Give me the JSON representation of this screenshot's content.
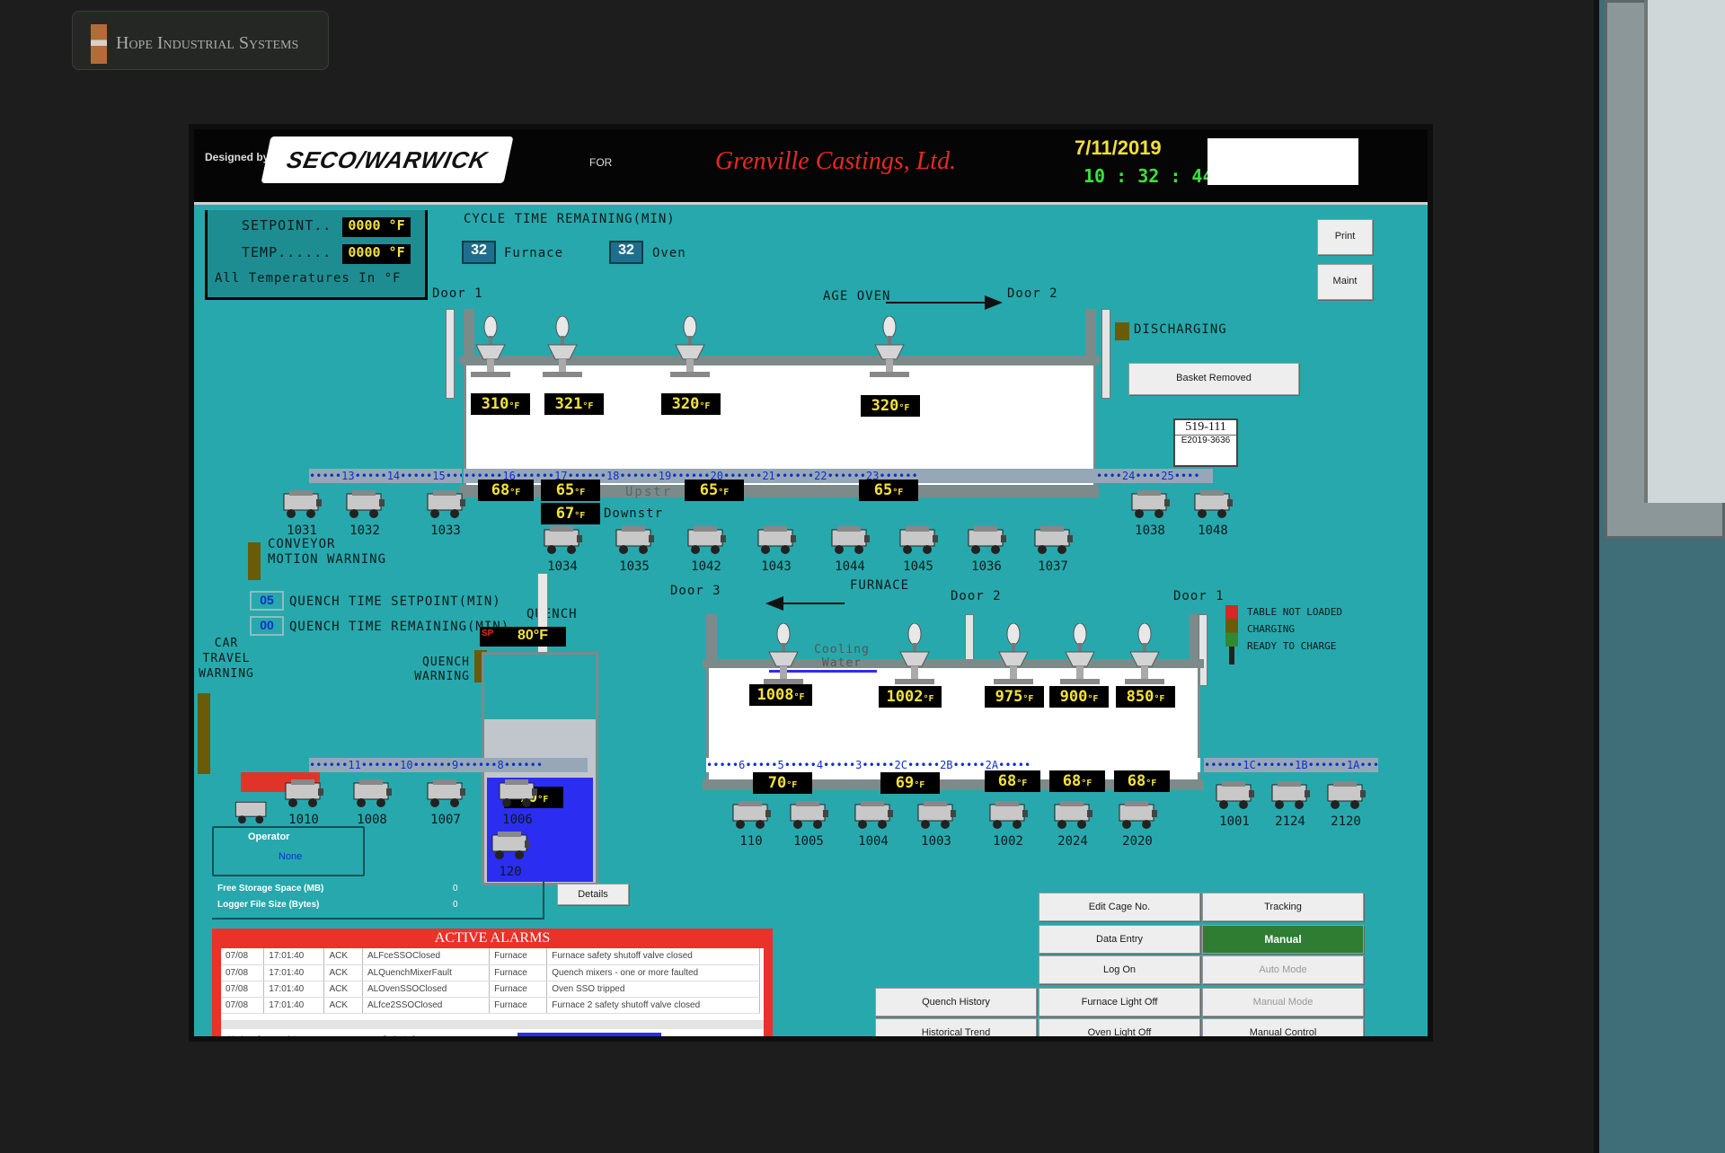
{
  "brand": "Hope Industrial Systems",
  "header": {
    "designed_by": "Designed by",
    "logo": "SECO/WARWICK",
    "for": "FOR",
    "customer": "Grenville Castings, Ltd.",
    "date": "7/11/2019",
    "time": "10 : 32 : 44"
  },
  "setpoint_panel": {
    "setpoint_label": "SETPOINT..",
    "setpoint_value": "0000",
    "temp_label": "TEMP......",
    "temp_value": "0000",
    "unit": "°F",
    "note": "All Temperatures In °F"
  },
  "cycle": {
    "title": "CYCLE TIME REMAINING(MIN)",
    "furnace_value": "32",
    "furnace_label": "Furnace",
    "oven_value": "32",
    "oven_label": "Oven"
  },
  "buttons": {
    "print": "Print",
    "maint": "Maint",
    "basket_removed": "Basket Removed",
    "details": "Details",
    "edit_cage": "Edit Cage No.",
    "tracking": "Tracking",
    "data_entry": "Data Entry",
    "manual": "Manual",
    "log_on": "Log On",
    "auto_mode": "Auto Mode",
    "quench_history": "Quench History",
    "furnace_light_off": "Furnace Light Off",
    "manual_mode": "Manual Mode",
    "historical_trend": "Historical Trend",
    "oven_light_off": "Oven Light Off",
    "manual_control": "Manual Control"
  },
  "age_oven": {
    "title": "AGE OVEN",
    "door1": "Door 1",
    "door2": "Door 2",
    "discharging": "DISCHARGING",
    "top_temps": [
      "310",
      "321",
      "320",
      "320"
    ],
    "bottom_temps": [
      "68",
      "65",
      "65",
      "65"
    ],
    "upstr_label": "Upstr",
    "downstr_value": "67",
    "downstr_label": "Downstr",
    "rail_positions": [
      "13",
      "14",
      "15",
      "16",
      "17",
      "18",
      "19",
      "20",
      "21",
      "22",
      "23",
      "24",
      "25"
    ],
    "tag_number": "519-111",
    "tag_code": "E2019-3636",
    "unit": "°F"
  },
  "upper_carts": {
    "left": [
      "1031",
      "1032",
      "1033"
    ],
    "mid": [
      "1034",
      "1035",
      "1042",
      "1043",
      "1044",
      "1045",
      "1036",
      "1037"
    ],
    "right": [
      "1038",
      "1048"
    ]
  },
  "conveyor_warning": "CONVEYOR MOTION WARNING",
  "quench": {
    "time_setpoint_value": "05",
    "time_setpoint_label": "QUENCH TIME SETPOINT(MIN)",
    "time_remaining_value": "00",
    "time_remaining_label": "QUENCH TIME REMAINING(MIN)",
    "title": "QUENCH",
    "sp_tag": "SP",
    "sp_value": "80°F",
    "warning": "QUENCH WARNING",
    "counter": "00",
    "tank_temp": "70",
    "unit": "°F"
  },
  "car_travel_warning": "CAR TRAVEL WARNING",
  "furnace": {
    "title": "FURNACE",
    "door3": "Door 3",
    "door2": "Door 2",
    "door1": "Door 1",
    "cooling_water": "Cooling Water",
    "top_temps": [
      "1008",
      "1002",
      "975",
      "900",
      "850"
    ],
    "bottom_temps": [
      "70",
      "69",
      "68",
      "68",
      "68"
    ],
    "rail_positions": [
      "11",
      "10",
      "9",
      "8",
      "6",
      "5",
      "4",
      "3",
      "2C",
      "2B",
      "2A",
      "1C",
      "1B",
      "1A"
    ],
    "unit": "°F"
  },
  "status_legend": [
    "TABLE NOT LOADED",
    "CHARGING",
    "READY TO CHARGE"
  ],
  "lower_carts": {
    "left": [
      "1010",
      "1008",
      "1007",
      "1006"
    ],
    "single": "120",
    "mid": [
      "110",
      "1005",
      "1004",
      "1003",
      "1002",
      "2024",
      "2020"
    ],
    "right": [
      "1001",
      "2124",
      "2120"
    ]
  },
  "operator": {
    "label": "Operator",
    "value": "None"
  },
  "storage": {
    "free_space_label": "Free Storage Space (MB)",
    "free_space_value": "0",
    "logger_label": "Logger File Size (Bytes)",
    "logger_value": "0"
  },
  "alarms": {
    "title": "ACTIVE ALARMS",
    "rows": [
      [
        "07/08",
        "17:01:40",
        "ACK",
        "ALFceSSOClosed",
        "Furnace",
        "Furnace safety shutoff valve closed"
      ],
      [
        "07/08",
        "17:01:40",
        "ACK",
        "ALQuenchMixerFault",
        "Furnace",
        "Quench mixers - one or more faulted"
      ],
      [
        "07/08",
        "17:01:40",
        "ACK",
        "ALOvenSSOClosed",
        "Furnace",
        "Oven SSO tripped"
      ],
      [
        "07/08",
        "17:01:40",
        "ACK",
        "ALfce2SSOClosed",
        "Furnace",
        "Furnace 2 safety shutoff valve closed"
      ]
    ],
    "footer_left": "Update Successful",
    "footer_mid": "Default Query"
  },
  "colors": {
    "screen_bg": "#27a8ad",
    "lcd_text": "#f5e23a",
    "manual_active": "#2e7d32",
    "alarm_frame": "#e8322a",
    "quench_water": "#2b2ef0",
    "customer_red": "#e82a22",
    "clock_green": "#39e23a"
  }
}
